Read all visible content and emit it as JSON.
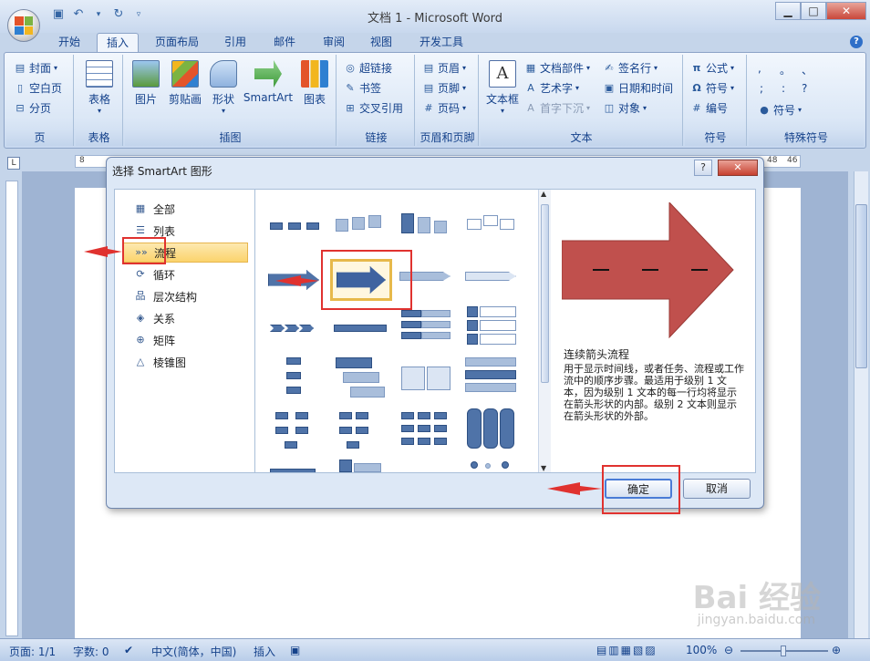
{
  "window": {
    "title": "文档 1 - Microsoft Word",
    "minimize": "▁",
    "maximize": "□",
    "close": "✕"
  },
  "ribbon_tabs": [
    "开始",
    "插入",
    "页面布局",
    "引用",
    "邮件",
    "审阅",
    "视图",
    "开发工具"
  ],
  "active_tab": "插入",
  "groups": {
    "pages": {
      "label": "页",
      "items": [
        "封面",
        "空白页",
        "分页"
      ]
    },
    "table": {
      "label": "表格",
      "button": "表格"
    },
    "illustrations": {
      "label": "插图",
      "items": [
        "图片",
        "剪贴画",
        "形状",
        "SmartArt",
        "图表"
      ]
    },
    "links": {
      "label": "链接",
      "items": [
        "超链接",
        "书签",
        "交叉引用"
      ]
    },
    "header_footer": {
      "label": "页眉和页脚",
      "items": [
        "页眉",
        "页脚",
        "页码"
      ]
    },
    "text": {
      "label": "文本",
      "items": [
        "文本框",
        "文档部件",
        "艺术字",
        "首字下沉",
        "签名行",
        "日期和时间",
        "对象"
      ]
    },
    "symbols": {
      "label": "符号",
      "items": [
        "公式",
        "符号",
        "编号"
      ]
    },
    "special": {
      "label": "特殊符号",
      "items": [
        ",",
        "。",
        "、",
        ";",
        ":",
        "?",
        "符号"
      ]
    }
  },
  "ruler": {
    "h_left": "8",
    "h_r1": "48",
    "h_r2": "46"
  },
  "dialog": {
    "title": "选择 SmartArt 图形",
    "help": "?",
    "close": "✕",
    "categories": [
      "全部",
      "列表",
      "流程",
      "循环",
      "层次结构",
      "关系",
      "矩阵",
      "棱锥图"
    ],
    "selected_category": "流程",
    "preview_title": "连续箭头流程",
    "preview_description": "用于显示时间线，或者任务、流程或工作流中的顺序步骤。最适用于级别 1 文本，因为级别 1 文本的每一行均将显示在箭头形状的内部。级别 2 文本则显示在箭头形状的外部。",
    "ok": "确定",
    "cancel": "取消"
  },
  "statusbar": {
    "page": "页面: 1/1",
    "words": "字数: 0",
    "language": "中文(简体，中国)",
    "mode": "插入",
    "zoom": "100%"
  },
  "watermark": {
    "main": "Bai 经验",
    "sub": "jingyan.baidu.com"
  },
  "colors": {
    "accent": "#15428b",
    "annotation": "#e0322f",
    "preview_arrow": "#c0504d",
    "selection": "#fbd36c"
  }
}
